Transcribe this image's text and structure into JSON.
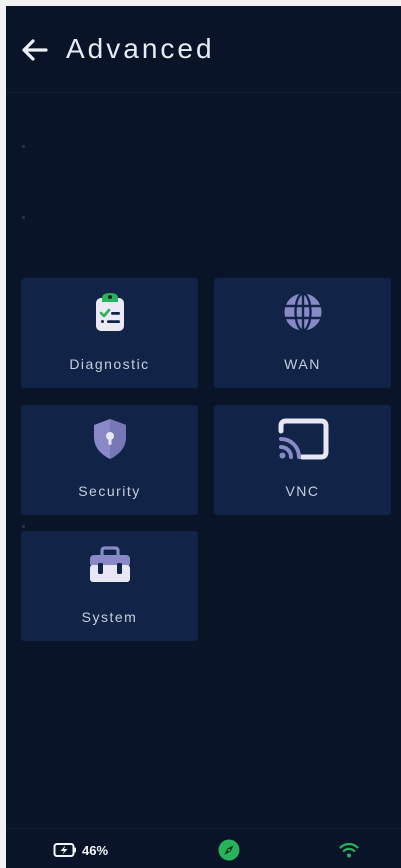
{
  "header": {
    "title": "Advanced",
    "back_icon": "arrow-left-icon"
  },
  "tiles": [
    {
      "label": "Diagnostic",
      "icon": "clipboard-checklist-icon"
    },
    {
      "label": "WAN",
      "icon": "globe-icon"
    },
    {
      "label": "Security",
      "icon": "shield-keyhole-icon"
    },
    {
      "label": "VNC",
      "icon": "cast-screen-icon"
    },
    {
      "label": "System",
      "icon": "toolbox-icon"
    }
  ],
  "status": {
    "battery": "46%",
    "battery_icon": "battery-charging-icon",
    "gps_icon": "compass-icon",
    "wifi_icon": "wifi-icon"
  },
  "colors": {
    "background": "#0a1428",
    "tile": "#112448",
    "icon_light": "#e9e6f4",
    "icon_purple": "#8a89c8",
    "accent_green": "#26b35a"
  }
}
